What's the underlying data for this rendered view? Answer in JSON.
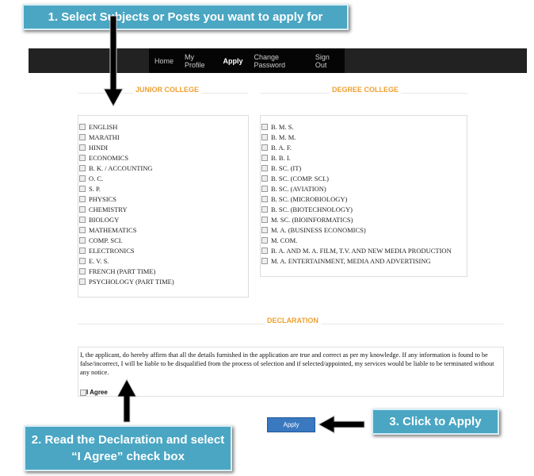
{
  "callouts": {
    "step1": "1. Select Subjects or Posts you want to apply for",
    "step2_line1": "2. Read the Declaration and select",
    "step2_line2": "“I Agree” check box",
    "step3": "3. Click to Apply"
  },
  "nav": {
    "items": [
      {
        "label": "Home"
      },
      {
        "label": "My Profile"
      },
      {
        "label": "Apply",
        "active": true
      },
      {
        "label": "Change Password"
      },
      {
        "label": "Sign Out"
      }
    ]
  },
  "junior": {
    "title": "JUNIOR COLLEGE",
    "items": [
      "ENGLISH",
      "MARATHI",
      "HINDI",
      "ECONOMICS",
      "B. K. / ACCOUNTING",
      "O. C.",
      "S. P.",
      "PHYSICS",
      "CHEMISTRY",
      "BIOLOGY",
      "MATHEMATICS",
      "COMP. SCI.",
      "ELECTRONICS",
      "E. V. S.",
      "FRENCH (PART TIME)",
      "PSYCHOLOGY (PART TIME)"
    ]
  },
  "degree": {
    "title": "DEGREE COLLEGE",
    "items": [
      "B. M. S.",
      "B. M. M.",
      "B. A. F.",
      "B. B. I.",
      "B. SC. (IT)",
      "B. SC. (COMP. SCI.)",
      "B. SC. (AVIATION)",
      "B. SC. (MICROBIOLOGY)",
      "B. SC. (BIOTECHNOLOGY)",
      "M. SC. (BIOINFORMATICS)",
      "M. A. (BUSINESS ECONOMICS)",
      "M. COM.",
      "B. A. AND M. A. FILM, T.V. AND NEW MEDIA PRODUCTION",
      "M. A. ENTERTAINMENT, MEDIA AND ADVERTISING"
    ]
  },
  "declaration": {
    "title": "DECLARATION",
    "text": "I, the applicant, do hereby affirm that all the details furnished in the application are true and correct as per my knowledge. If any information is found to be false/incorrect, I will be liable to be disqualified from the process of selection and if selected/appointed, my services would be liable to be terminated without any notice.",
    "agree_label": "I Agree"
  },
  "apply_label": "Apply",
  "colors": {
    "accent": "#f0a030",
    "callout": "#4aa6c3",
    "button": "#3a78c0"
  }
}
